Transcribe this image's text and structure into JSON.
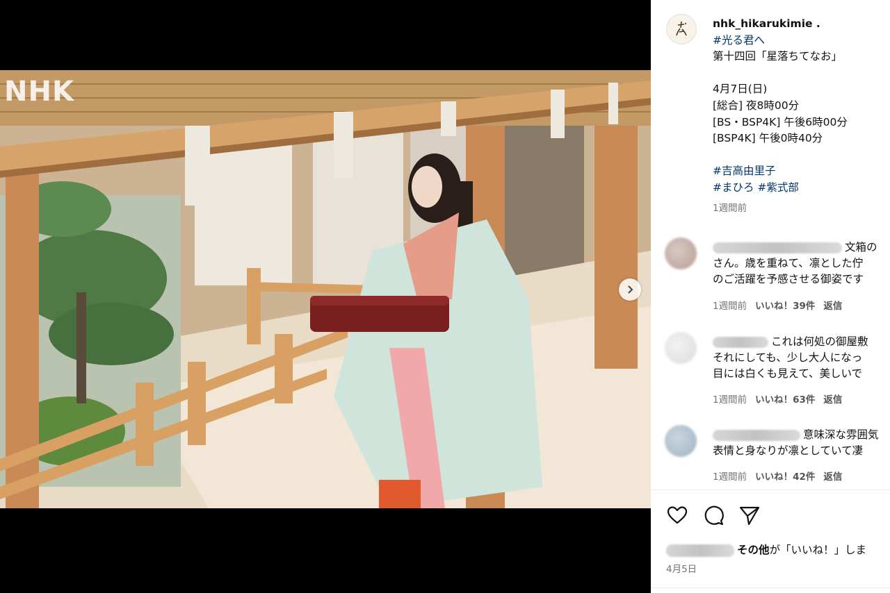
{
  "media": {
    "watermark": "NHK",
    "next_icon": "chevron-right-icon"
  },
  "post": {
    "username": "nhk_hikarukimie .",
    "hashtag_show": "#光る君へ",
    "episode": "第十四回「星落ちてなお」",
    "air_date": "4月7日(日)",
    "schedule": [
      "[総合] 夜8時00分",
      "[BS・BSP4K] 午後6時00分",
      "[BSP4K] 午後0時40分"
    ],
    "hashtag_actress": "#吉高由里子",
    "hashtags_roles": "#まひろ #紫式部",
    "time_ago": "1週間前"
  },
  "comments": [
    {
      "text_line1": "文箱の",
      "text_line2": "さん。歳を重ねて、凛とした佇",
      "text_line3": "のご活躍を予感させる御姿です",
      "time": "1週間前",
      "likes": "いいね！39件",
      "reply": "返信"
    },
    {
      "text_line1": "これは何処の御屋敷",
      "text_line2": "それにしても、少し大人になっ",
      "text_line3": "目には白くも見えて、美しいで",
      "time": "1週間前",
      "likes": "いいね！63件",
      "reply": "返信"
    },
    {
      "text_line1": "意味深な雰囲気",
      "text_line2": "表情と身なりが凛としていて凄",
      "time": "1週間前",
      "likes": "いいね！42件",
      "reply": "返信"
    }
  ],
  "footer": {
    "like_icon": "heart-icon",
    "comment_icon": "comment-icon",
    "share_icon": "share-icon",
    "likes_prefix": "その他",
    "likes_suffix": "が「いいね！」しま",
    "date": "4月5日"
  }
}
